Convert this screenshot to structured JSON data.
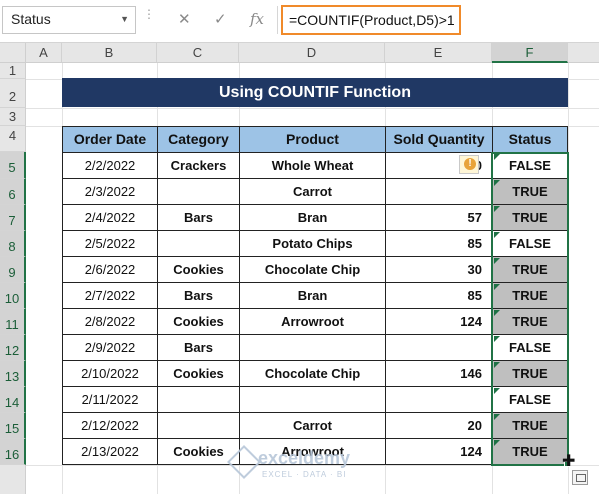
{
  "name_box": {
    "value": "Status"
  },
  "formula_bar": {
    "cancel_glyph": "✕",
    "enter_glyph": "✓",
    "fx_glyph": "fx",
    "formula": "=COUNTIF(Product,D5)>1"
  },
  "columns": [
    "A",
    "B",
    "C",
    "D",
    "E",
    "F"
  ],
  "rows": [
    "1",
    "2",
    "3",
    "4",
    "5",
    "6",
    "7",
    "8",
    "9",
    "10",
    "11",
    "12",
    "13",
    "14",
    "15",
    "16"
  ],
  "title": "Using COUNTIF Function",
  "table": {
    "headers": [
      "Order Date",
      "Category",
      "Product",
      "Sold Quantity",
      "Status"
    ],
    "rows": [
      {
        "date": "2/2/2022",
        "category": "Crackers",
        "product": "Whole Wheat",
        "qty": "30",
        "status": "FALSE"
      },
      {
        "date": "2/3/2022",
        "category": "",
        "product": "Carrot",
        "qty": "",
        "status": "TRUE"
      },
      {
        "date": "2/4/2022",
        "category": "Bars",
        "product": "Bran",
        "qty": "57",
        "status": "TRUE"
      },
      {
        "date": "2/5/2022",
        "category": "",
        "product": "Potato Chips",
        "qty": "85",
        "status": "FALSE"
      },
      {
        "date": "2/6/2022",
        "category": "Cookies",
        "product": "Chocolate Chip",
        "qty": "30",
        "status": "TRUE"
      },
      {
        "date": "2/7/2022",
        "category": "Bars",
        "product": "Bran",
        "qty": "85",
        "status": "TRUE"
      },
      {
        "date": "2/8/2022",
        "category": "Cookies",
        "product": "Arrowroot",
        "qty": "124",
        "status": "TRUE"
      },
      {
        "date": "2/9/2022",
        "category": "Bars",
        "product": "",
        "qty": "",
        "status": "FALSE"
      },
      {
        "date": "2/10/2022",
        "category": "Cookies",
        "product": "Chocolate Chip",
        "qty": "146",
        "status": "TRUE"
      },
      {
        "date": "2/11/2022",
        "category": "",
        "product": "",
        "qty": "",
        "status": "FALSE"
      },
      {
        "date": "2/12/2022",
        "category": "",
        "product": "Carrot",
        "qty": "20",
        "status": "TRUE"
      },
      {
        "date": "2/13/2022",
        "category": "Cookies",
        "product": "Arrowroot",
        "qty": "124",
        "status": "TRUE"
      }
    ]
  },
  "warning_glyph": "!",
  "watermark": {
    "name": "exceldemy",
    "tagline": "EXCEL · DATA · BI"
  },
  "colors": {
    "title_bg": "#203864",
    "header_bg": "#9dc3e6",
    "true_fill": "#bfbfbf",
    "selection": "#217346",
    "formula_outline": "#f08a2a"
  }
}
